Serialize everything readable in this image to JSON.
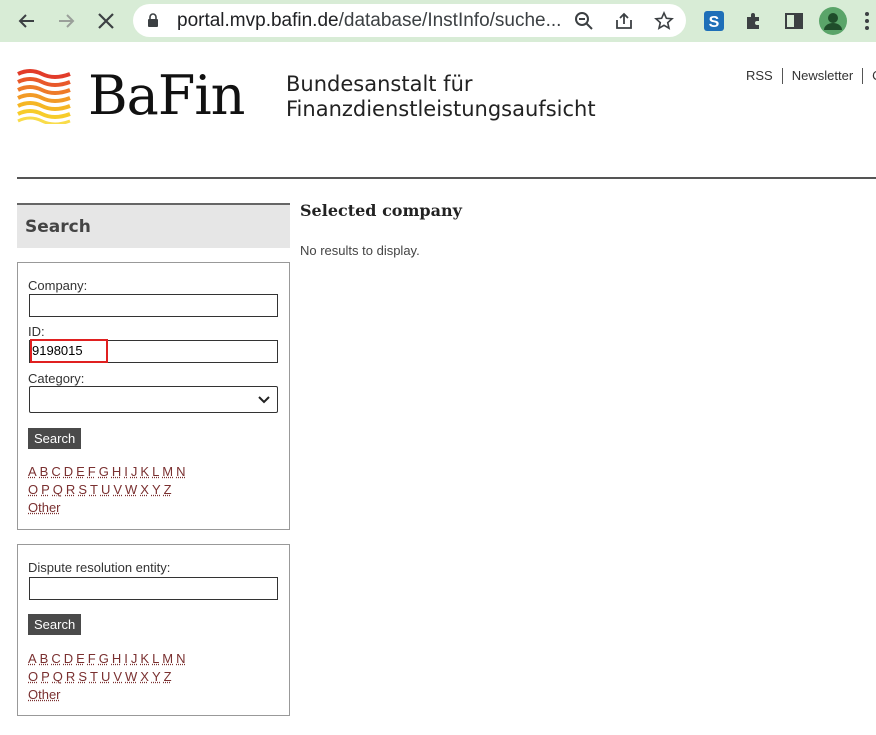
{
  "browser": {
    "url_host": "portal.mvp.bafin.de",
    "url_path": "/database/InstInfo/suche..."
  },
  "header": {
    "logo_text": "BaFin",
    "org_line1": "Bundesanstalt für",
    "org_line2": "Finanzdienstleistungsaufsicht",
    "links": [
      "RSS",
      "Newsletter",
      "C"
    ]
  },
  "search": {
    "heading": "Search",
    "company_label": "Company:",
    "company_value": "",
    "id_label": "ID:",
    "id_value": "9198015",
    "category_label": "Category:",
    "category_value": "",
    "button": "Search",
    "alpha_row1": [
      "A",
      "B",
      "C",
      "D",
      "E",
      "F",
      "G",
      "H",
      "I",
      "J",
      "K",
      "L",
      "M",
      "N"
    ],
    "alpha_row2": [
      "O",
      "P",
      "Q",
      "R",
      "S",
      "T",
      "U",
      "V",
      "W",
      "X",
      "Y",
      "Z"
    ],
    "other": "Other"
  },
  "dispute": {
    "label": "Dispute resolution entity:",
    "value": "",
    "button": "Search",
    "alpha_row1": [
      "A",
      "B",
      "C",
      "D",
      "E",
      "F",
      "G",
      "H",
      "I",
      "J",
      "K",
      "L",
      "M",
      "N"
    ],
    "alpha_row2": [
      "O",
      "P",
      "Q",
      "R",
      "S",
      "T",
      "U",
      "V",
      "W",
      "X",
      "Y",
      "Z"
    ],
    "other": "Other"
  },
  "results": {
    "title": "Selected company",
    "message": "No results to display."
  },
  "colors": {
    "chrome_bg": "#d8ecd6",
    "link": "#7a3030",
    "highlight": "#e02020"
  }
}
